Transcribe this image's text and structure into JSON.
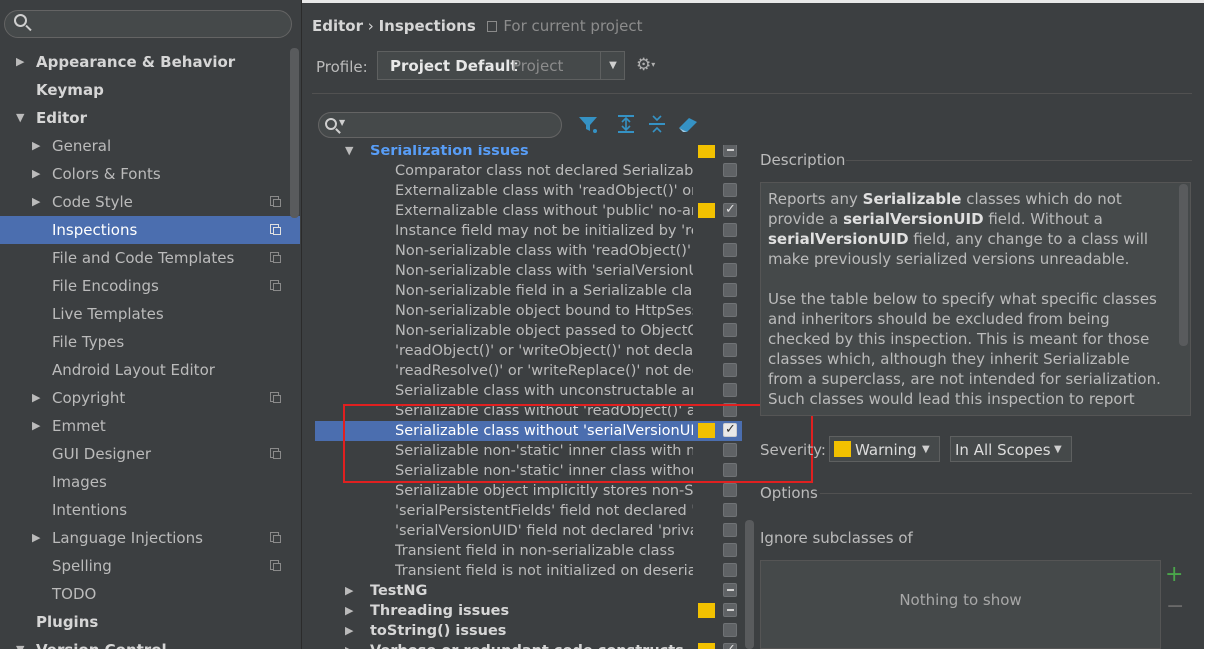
{
  "sidebar": {
    "items": [
      {
        "label": "Appearance & Behavior",
        "level": 0,
        "arrow": "▶",
        "bold": true,
        "project": false
      },
      {
        "label": "Keymap",
        "level": 0,
        "arrow": "",
        "bold": true,
        "project": false
      },
      {
        "label": "Editor",
        "level": 0,
        "arrow": "▼",
        "bold": true,
        "project": false
      },
      {
        "label": "General",
        "level": 1,
        "arrow": "▶",
        "bold": false,
        "project": false
      },
      {
        "label": "Colors & Fonts",
        "level": 1,
        "arrow": "▶",
        "bold": false,
        "project": false
      },
      {
        "label": "Code Style",
        "level": 1,
        "arrow": "▶",
        "bold": false,
        "project": true
      },
      {
        "label": "Inspections",
        "level": 1,
        "arrow": "",
        "bold": false,
        "project": true,
        "selected": true
      },
      {
        "label": "File and Code Templates",
        "level": 1,
        "arrow": "",
        "bold": false,
        "project": true
      },
      {
        "label": "File Encodings",
        "level": 1,
        "arrow": "",
        "bold": false,
        "project": true
      },
      {
        "label": "Live Templates",
        "level": 1,
        "arrow": "",
        "bold": false,
        "project": false
      },
      {
        "label": "File Types",
        "level": 1,
        "arrow": "",
        "bold": false,
        "project": false
      },
      {
        "label": "Android Layout Editor",
        "level": 1,
        "arrow": "",
        "bold": false,
        "project": false
      },
      {
        "label": "Copyright",
        "level": 1,
        "arrow": "▶",
        "bold": false,
        "project": true
      },
      {
        "label": "Emmet",
        "level": 1,
        "arrow": "▶",
        "bold": false,
        "project": false
      },
      {
        "label": "GUI Designer",
        "level": 1,
        "arrow": "",
        "bold": false,
        "project": true
      },
      {
        "label": "Images",
        "level": 1,
        "arrow": "",
        "bold": false,
        "project": false
      },
      {
        "label": "Intentions",
        "level": 1,
        "arrow": "",
        "bold": false,
        "project": false
      },
      {
        "label": "Language Injections",
        "level": 1,
        "arrow": "▶",
        "bold": false,
        "project": true
      },
      {
        "label": "Spelling",
        "level": 1,
        "arrow": "",
        "bold": false,
        "project": true
      },
      {
        "label": "TODO",
        "level": 1,
        "arrow": "",
        "bold": false,
        "project": false
      },
      {
        "label": "Plugins",
        "level": 0,
        "arrow": "",
        "bold": true,
        "project": false
      },
      {
        "label": "Version Control",
        "level": 0,
        "arrow": "▼",
        "bold": true,
        "project": false
      }
    ]
  },
  "header": {
    "breadcrumb_editor": "Editor",
    "breadcrumb_sep": "›",
    "breadcrumb_current": "Inspections",
    "scope_note": "For current project"
  },
  "profile": {
    "label": "Profile:",
    "name": "Project Default",
    "scope": "Project"
  },
  "inspections": {
    "group_open": "Serialization issues",
    "items": [
      {
        "label": "Comparator class not declared Serializable",
        "sev": false,
        "check": "off"
      },
      {
        "label": "Externalizable class with 'readObject()' or 'writeObject()'",
        "sev": false,
        "check": "off"
      },
      {
        "label": "Externalizable class without 'public' no-arg constructor",
        "sev": true,
        "check": "on"
      },
      {
        "label": "Instance field may not be initialized by 'readObject()'",
        "sev": false,
        "check": "off"
      },
      {
        "label": "Non-serializable class with 'readObject()' or 'writeObject()'",
        "sev": false,
        "check": "off"
      },
      {
        "label": "Non-serializable class with 'serialVersionUID'",
        "sev": false,
        "check": "off"
      },
      {
        "label": "Non-serializable field in a Serializable class",
        "sev": false,
        "check": "off"
      },
      {
        "label": "Non-serializable object bound to HttpSession",
        "sev": false,
        "check": "off"
      },
      {
        "label": "Non-serializable object passed to ObjectOutputStream",
        "sev": false,
        "check": "off"
      },
      {
        "label": "'readObject()' or 'writeObject()' not declared 'private'",
        "sev": false,
        "check": "off"
      },
      {
        "label": "'readResolve()' or 'writeReplace()' not declared 'protected'",
        "sev": false,
        "check": "off"
      },
      {
        "label": "Serializable class with unconstructable ancestor",
        "sev": false,
        "check": "off"
      },
      {
        "label": "Serializable class without 'readObject()' and 'writeObject()'",
        "sev": false,
        "check": "off"
      },
      {
        "label": "Serializable class without 'serialVersionUID'",
        "sev": true,
        "check": "on",
        "selected": true
      },
      {
        "label": "Serializable non-'static' inner class with non-Serializable outer class",
        "sev": false,
        "check": "off"
      },
      {
        "label": "Serializable non-'static' inner class without 'serialVersionUID'",
        "sev": false,
        "check": "off"
      },
      {
        "label": "Serializable object implicitly stores non-Serializable object",
        "sev": false,
        "check": "off"
      },
      {
        "label": "'serialPersistentFields' field not declared 'private static final'",
        "sev": false,
        "check": "off"
      },
      {
        "label": "'serialVersionUID' field not declared 'private static final long'",
        "sev": false,
        "check": "off"
      },
      {
        "label": "Transient field in non-serializable class",
        "sev": false,
        "check": "off"
      },
      {
        "label": "Transient field is not initialized on deserialization",
        "sev": false,
        "check": "off"
      }
    ],
    "groups_after": [
      {
        "label": "TestNG",
        "sev": false,
        "check": "partial"
      },
      {
        "label": "Threading issues",
        "sev": true,
        "check": "partial"
      },
      {
        "label": "toString() issues",
        "sev": false,
        "check": "off"
      },
      {
        "label": "Verbose or redundant code constructs",
        "sev": true,
        "check": "on"
      }
    ]
  },
  "description": {
    "title": "Description",
    "p1_a": "Reports any ",
    "p1_b": "Serializable",
    "p1_c": " classes which do not provide a ",
    "p1_d": "serialVersionUID",
    "p1_e": " field. Without a ",
    "p1_f": "serialVersionUID",
    "p1_g": " field, any change to a class will make previously serialized versions unreadable.",
    "p2": "Use the table below to specify what specific classes and inheritors should be excluded from being checked by this inspection. This is meant for those classes which, although they inherit Serializable from a superclass, are not intended for serialization. Such classes would lead this inspection to report"
  },
  "severity": {
    "label": "Severity:",
    "value": "Warning",
    "scope": "In All Scopes",
    "warning_color": "#f2c100"
  },
  "options": {
    "title": "Options",
    "ignore_label": "Ignore subclasses of",
    "empty_text": "Nothing to show",
    "add": "+",
    "remove": "−"
  },
  "icons": {
    "filter": "filter-icon",
    "expand_all": "expand-all-icon",
    "collapse_all": "collapse-all-icon",
    "reset": "eraser-icon",
    "gear": "gear-icon"
  }
}
